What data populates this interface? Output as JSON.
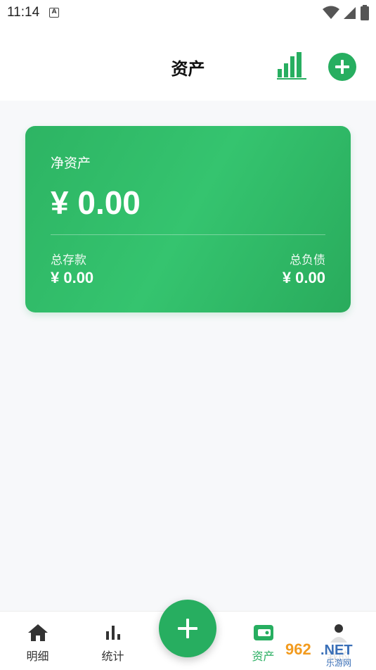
{
  "status_bar": {
    "time": "11:14",
    "notification_icon": "A"
  },
  "header": {
    "title": "资产",
    "stats_icon": "bar-chart-icon",
    "add_icon": "plus-icon"
  },
  "asset_card": {
    "net_assets_label": "净资产",
    "net_assets_value": "¥ 0.00",
    "total_deposit_label": "总存款",
    "total_deposit_value": "¥ 0.00",
    "total_debt_label": "总负债",
    "total_debt_value": "¥ 0.00"
  },
  "bottom_nav": {
    "items": [
      {
        "label": "明细",
        "icon": "home-icon"
      },
      {
        "label": "统计",
        "icon": "bar-chart-icon"
      },
      {
        "label": "资产",
        "icon": "wallet-icon",
        "active": true
      },
      {
        "label": "我的",
        "icon": "person-icon"
      }
    ],
    "fab_icon": "plus-icon"
  },
  "watermark": {
    "brand": "962.NET",
    "sub": "乐游网"
  },
  "colors": {
    "accent": "#27ae60",
    "card_start": "#2db463",
    "card_end": "#29ab5c"
  }
}
